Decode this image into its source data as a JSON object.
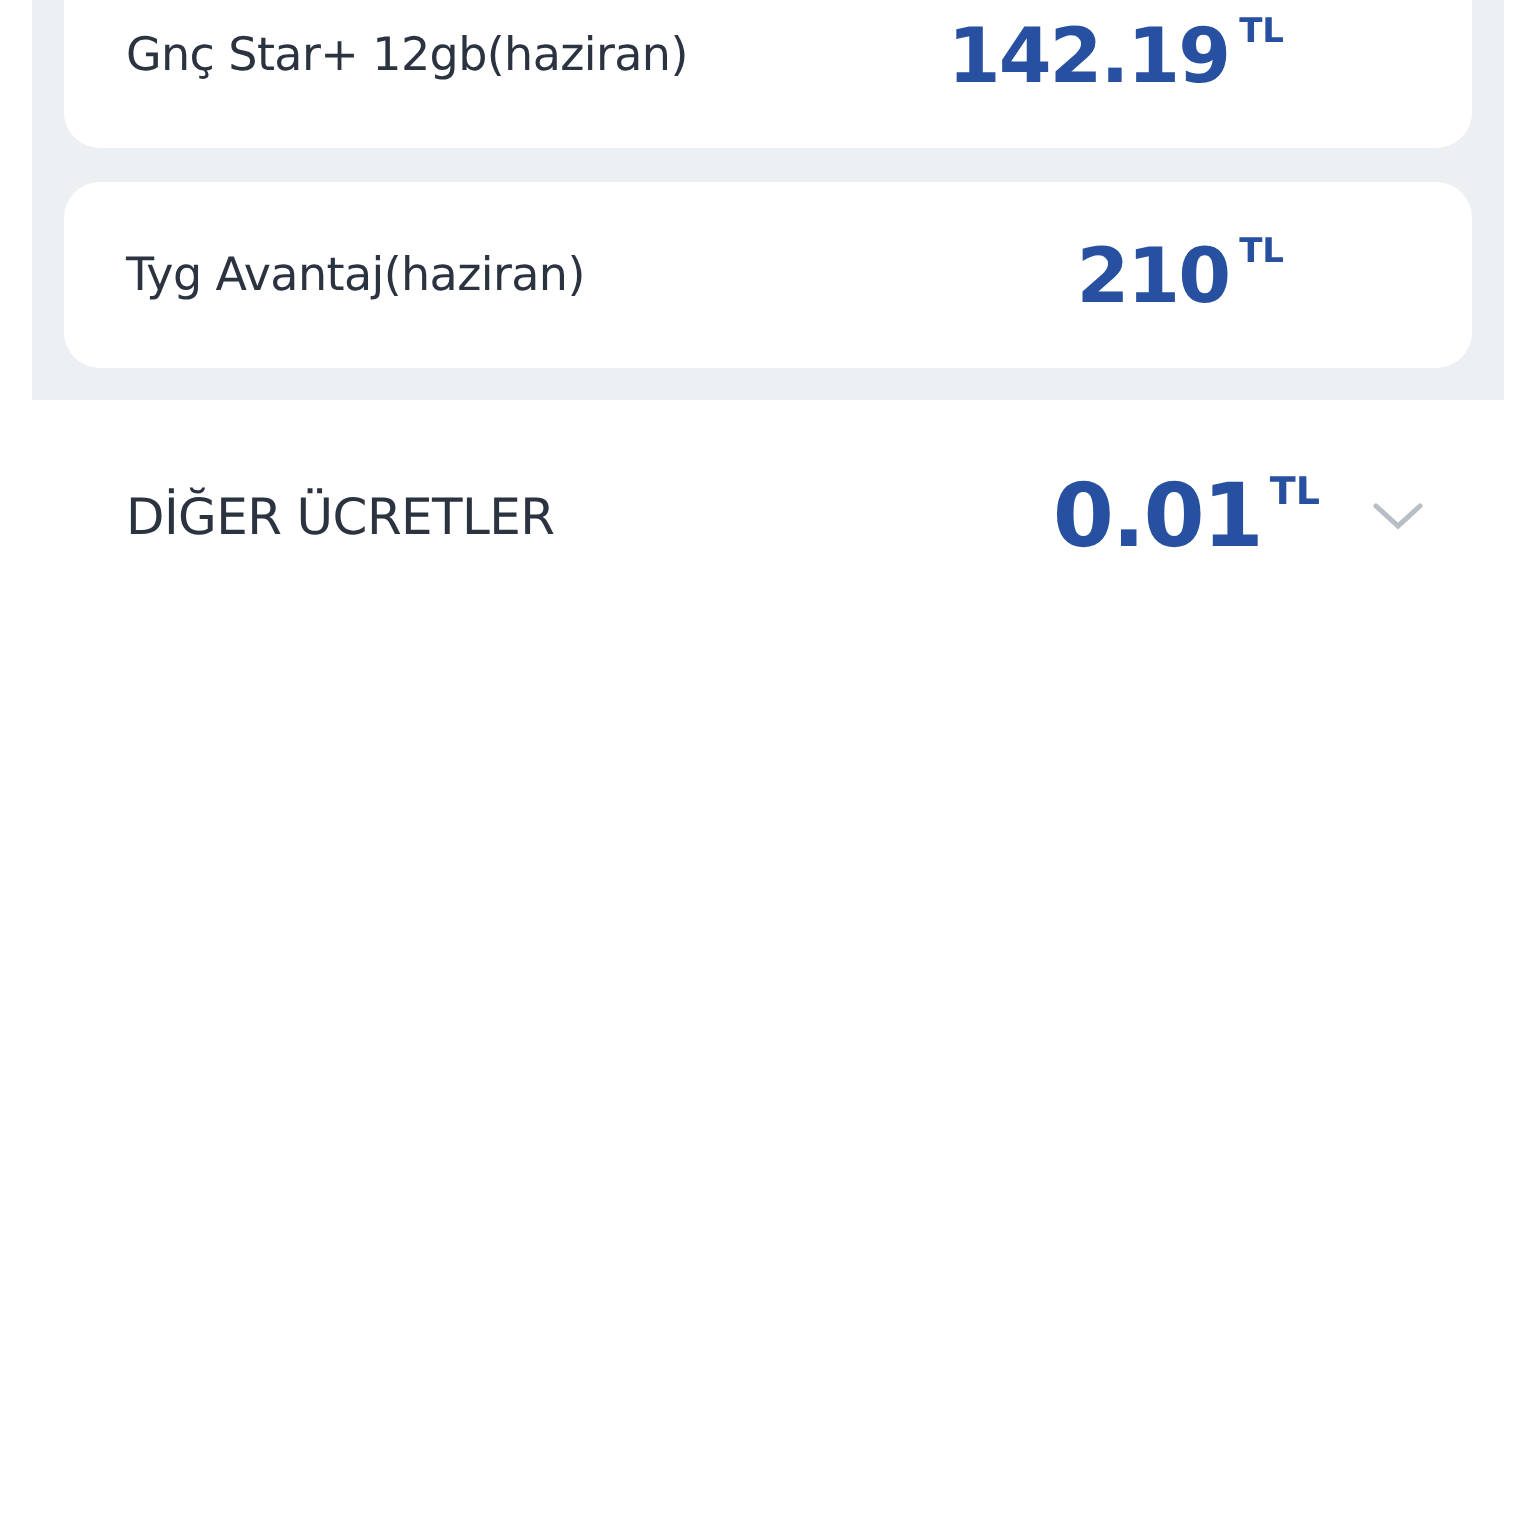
{
  "charges": [
    {
      "name": "Gnç Star+ 12gb(haziran)",
      "amount": "142.19",
      "currency": "TL"
    },
    {
      "name": "Tyg Avantaj(haziran)",
      "amount": "210",
      "currency": "TL"
    }
  ],
  "other_charges": {
    "label": "DİĞER ÜCRETLER",
    "amount": "0.01",
    "currency": "TL",
    "expanded": false
  }
}
